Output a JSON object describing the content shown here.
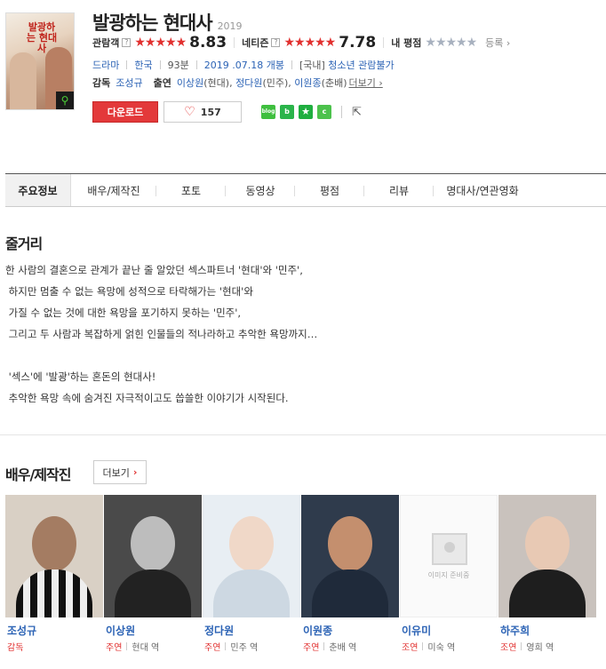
{
  "movie": {
    "title": "발광하는 현대사",
    "year": "2019",
    "poster_title": "발광하는 현대사"
  },
  "ratings": {
    "audience_label": "관람객",
    "audience_stars": "★★★★★",
    "audience_score": "8.83",
    "netizen_label": "네티즌",
    "netizen_stars": "★★★★★",
    "netizen_score": "7.78",
    "my_label": "내 평점",
    "my_stars": "★★★★★",
    "register_label": "등록 ›",
    "help_glyph": "?"
  },
  "info": {
    "genre": "드라마",
    "country": "한국",
    "runtime": "93분",
    "release": "2019 .07.18 개봉",
    "grade_prefix": "[국내]",
    "grade": "청소년 관람불가"
  },
  "credits": {
    "director_label": "감독",
    "director": "조성규",
    "cast_label": "출연",
    "cast1": "이상원",
    "cast1_role": "(현대),",
    "cast2": "정다원",
    "cast2_role": "(민주),",
    "cast3": "이원종",
    "cast3_role": "(춘배)",
    "more": "더보기 ›"
  },
  "actions": {
    "download": "다운로드",
    "like_count": "157",
    "heart": "♡",
    "share_blog": "blog",
    "share_band": "b",
    "share_star": "★",
    "share_cafe": "c",
    "share_icon": "⇱"
  },
  "tabs": [
    {
      "label": "주요정보"
    },
    {
      "label": "배우/제작진"
    },
    {
      "label": "포토"
    },
    {
      "label": "동영상"
    },
    {
      "label": "평점"
    },
    {
      "label": "리뷰"
    },
    {
      "label": "명대사/연관영화"
    }
  ],
  "synopsis": {
    "heading": "줄거리",
    "lines": [
      "한 사람의 결혼으로 관계가 끝난 줄 알았던 섹스파트너 '현대'와 '민주',",
      " 하지만 멈출 수 없는 욕망에 성적으로 타락해가는 '현대'와",
      " 가질 수 없는 것에 대한 욕망을 포기하지 못하는 '민주',",
      " 그리고 두 사람과 복잡하게 얽힌 인물들의 적나라하고 추악한 욕망까지…",
      "",
      " '섹스'에 '발광'하는 혼돈의 현대사!",
      " 추악한 욕망 속에 숨겨진 자극적이고도 씁쓸한 이야기가 시작된다."
    ]
  },
  "cast_section": {
    "heading": "배우/제작진",
    "more_label": "더보기",
    "more_chevron": "›",
    "placeholder_text": "이미지 준비중",
    "members": [
      {
        "name": "조성규",
        "role": "감독",
        "character": ""
      },
      {
        "name": "이상원",
        "role": "주연",
        "character": "현대 역"
      },
      {
        "name": "정다원",
        "role": "주연",
        "character": "민주 역"
      },
      {
        "name": "이원종",
        "role": "주연",
        "character": "춘배 역"
      },
      {
        "name": "이유미",
        "role": "조연",
        "character": "미숙 역"
      },
      {
        "name": "하주희",
        "role": "조연",
        "character": "영희 역"
      }
    ]
  },
  "colors": {
    "accent_red": "#e3393a",
    "link_blue": "#2c63b5",
    "star_gray": "#a8b1bf"
  }
}
